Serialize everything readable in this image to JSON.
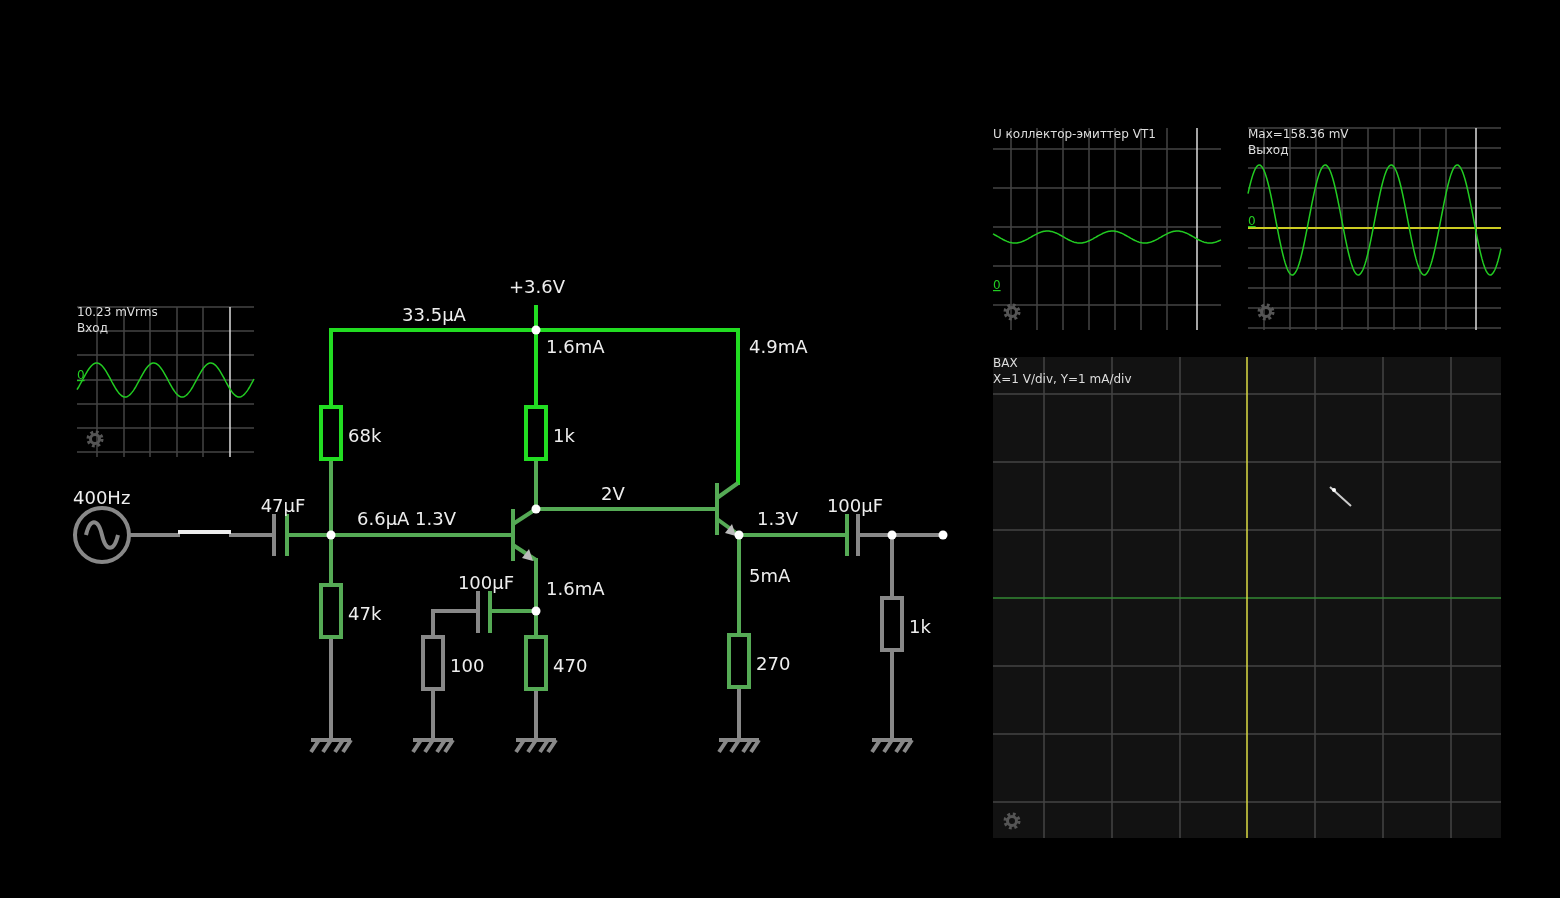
{
  "circuit": {
    "supply": "+3.6V",
    "source": {
      "frequency": "400Hz"
    },
    "resistors": [
      {
        "value": "68k"
      },
      {
        "value": "1k"
      },
      {
        "value": "47k"
      },
      {
        "value": "100"
      },
      {
        "value": "470"
      },
      {
        "value": "270"
      },
      {
        "value": "1k"
      }
    ],
    "capacitors": [
      {
        "value": "47μF"
      },
      {
        "value": "100μF"
      },
      {
        "value": "100μF"
      }
    ],
    "readings": [
      "33.5μA",
      "1.6mA",
      "4.9mA",
      "2V",
      "6.6μA 1.3V",
      "1.3V",
      "1.6mA",
      "5mA"
    ]
  },
  "scopes": [
    {
      "readout": "10.23 mVrms",
      "title": "Вход",
      "zero_label": "0"
    },
    {
      "title": "U коллектор-эмиттер VT1",
      "zero_label": "0"
    },
    {
      "readout": "Max=158.36 mV",
      "title": "Выход",
      "zero_label": "0"
    }
  ],
  "plotter": {
    "title": "BAX",
    "scale": "X=1 V/div, Y=1 mA/div"
  }
}
